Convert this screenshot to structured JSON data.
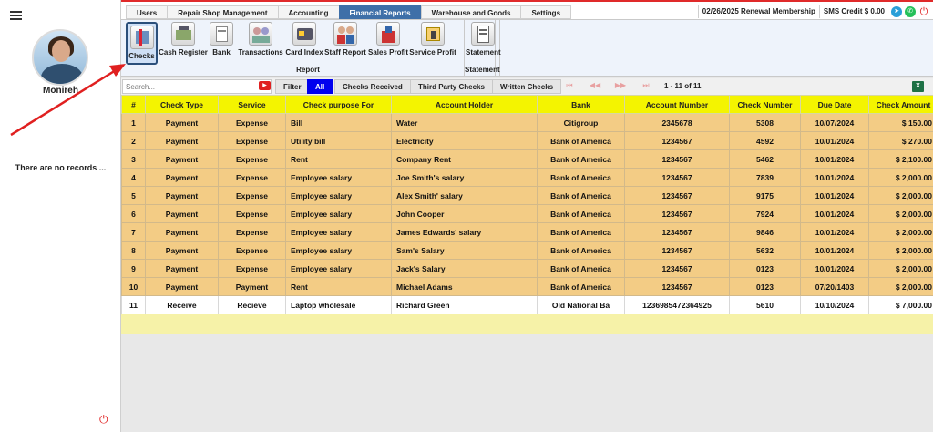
{
  "sidebar": {
    "user_name": "Monireh",
    "empty_text": "There are no records ..."
  },
  "topnav": {
    "tabs": [
      "Users",
      "Repair Shop Management",
      "Accounting",
      "Financial Reports",
      "Warehouse and Goods",
      "Settings"
    ],
    "active_tab": "Financial Reports",
    "renewal": "02/26/2025 Renewal Membership",
    "sms_credit": "SMS Credit $ 0.00"
  },
  "ribbon": {
    "report_group_title": "Report",
    "statement_group_title": "Statement",
    "report_buttons": [
      "Checks",
      "Cash Register",
      "Bank",
      "Transactions",
      "Card Index",
      "Staff Report",
      "Sales Profit",
      "Service Profit"
    ],
    "statement_button": "Statement",
    "active_button": "Checks"
  },
  "filterbar": {
    "search_placeholder": "Search...",
    "filter_label": "Filter",
    "all_label": "All",
    "received_label": "Checks Received",
    "third_party_label": "Third Party Checks",
    "written_label": "Written Checks",
    "pager_text": "1 - 11 of 11",
    "excel_label": "X"
  },
  "table": {
    "headers": [
      "#",
      "Check Type",
      "Service",
      "Check purpose For",
      "Account Holder",
      "Bank",
      "Account Number",
      "Check Number",
      "Due Date",
      "Check Amount"
    ],
    "rows": [
      [
        "1",
        "Payment",
        "Expense",
        "Bill",
        "Water",
        "Citigroup",
        "2345678",
        "5308",
        "10/07/2024",
        "$ 150.00"
      ],
      [
        "2",
        "Payment",
        "Expense",
        "Utility bill",
        "Electricity",
        "Bank of America",
        "1234567",
        "4592",
        "10/01/2024",
        "$ 270.00"
      ],
      [
        "3",
        "Payment",
        "Expense",
        "Rent",
        "Company Rent",
        "Bank of America",
        "1234567",
        "5462",
        "10/01/2024",
        "$ 2,100.00"
      ],
      [
        "4",
        "Payment",
        "Expense",
        "Employee salary",
        "Joe Smith's salary",
        "Bank of America",
        "1234567",
        "7839",
        "10/01/2024",
        "$ 2,000.00"
      ],
      [
        "5",
        "Payment",
        "Expense",
        "Employee salary",
        "Alex Smith' salary",
        "Bank of America",
        "1234567",
        "9175",
        "10/01/2024",
        "$ 2,000.00"
      ],
      [
        "6",
        "Payment",
        "Expense",
        "Employee salary",
        "John Cooper",
        "Bank of America",
        "1234567",
        "7924",
        "10/01/2024",
        "$ 2,000.00"
      ],
      [
        "7",
        "Payment",
        "Expense",
        "Employee salary",
        "James Edwards' salary",
        "Bank of America",
        "1234567",
        "9846",
        "10/01/2024",
        "$ 2,000.00"
      ],
      [
        "8",
        "Payment",
        "Expense",
        "Employee salary",
        "Sam's Salary",
        "Bank of America",
        "1234567",
        "5632",
        "10/01/2024",
        "$ 2,000.00"
      ],
      [
        "9",
        "Payment",
        "Expense",
        "Employee salary",
        "Jack's Salary",
        "Bank of America",
        "1234567",
        "0123",
        "10/01/2024",
        "$ 2,000.00"
      ],
      [
        "10",
        "Payment",
        "Payment",
        "Rent",
        "Michael Adams",
        "Bank of America",
        "1234567",
        "0123",
        "07/20/1403",
        "$ 2,000.00"
      ],
      [
        "11",
        "Receive",
        "Recieve",
        "Laptop wholesale",
        "Richard Green",
        "Old National Ba",
        "1236985472364925",
        "5610",
        "10/10/2024",
        "$ 7,000.00"
      ]
    ]
  },
  "colors": {
    "header_yellow": "#f4f400",
    "payment_row": "#f3cc85",
    "active_tab": "#3e6fa8",
    "all_button": "#0000ee",
    "annotation_arrow": "#e02020"
  }
}
